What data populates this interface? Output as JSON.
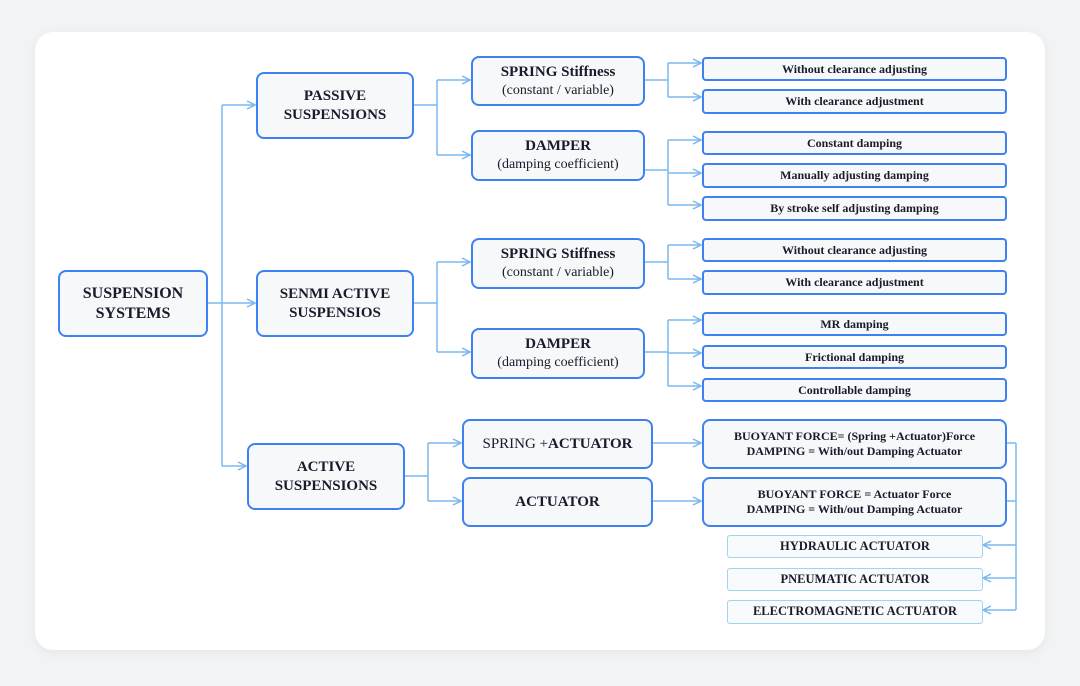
{
  "root": {
    "label": "SUSPENSION SYSTEMS"
  },
  "passive": {
    "label": "PASSIVE SUSPENSIONS",
    "spring": {
      "title": "SPRING Stiffness",
      "subtitle": "(constant / variable)",
      "children": [
        "Without clearance adjusting",
        "With clearance adjustment"
      ]
    },
    "damper": {
      "title": "DAMPER",
      "subtitle": "(damping coefficient)",
      "children": [
        "Constant  damping",
        "Manually adjusting  damping",
        "By stroke self adjusting  damping"
      ]
    }
  },
  "semi": {
    "label": "SENMI ACTIVE SUSPENSIOS",
    "spring": {
      "title": "SPRING  Stiffness",
      "subtitle": "(constant / variable)",
      "children": [
        "Without clearance adjusting",
        "With clearance adjustment"
      ]
    },
    "damper": {
      "title": "DAMPER",
      "subtitle": "(damping coefficient)",
      "children": [
        "MR damping",
        "Frictional  damping",
        "Controllable  damping"
      ]
    }
  },
  "active": {
    "label": "ACTIVE SUSPENSIONS",
    "spring_actuator": {
      "prefix": "SPRING +",
      "bold": "ACTUATOR",
      "result": [
        "BUOYANT FORCE=  (Spring +Actuator)Force",
        "DAMPING  =  With/out  Damping Actuator"
      ]
    },
    "actuator": {
      "label": "ACTUATOR",
      "result": [
        "BUOYANT FORCE  =  Actuator  Force",
        "DAMPING  =  With/out Damping Actuator"
      ]
    },
    "types": [
      "HYDRAULIC  ACTUATOR",
      "PNEUMATIC  ACTUATOR",
      "ELECTROMAGNETIC   ACTUATOR"
    ]
  },
  "colors": {
    "box_border": "#3d82f0",
    "connector": "#7ab8f0",
    "light_border": "#9fd4f2"
  }
}
